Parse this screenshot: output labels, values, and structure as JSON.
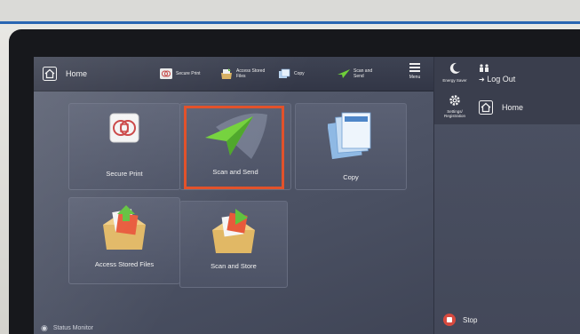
{
  "header": {
    "home_label": "Home",
    "shortcuts": [
      {
        "label": "Secure Print"
      },
      {
        "label": "Access Stored Files"
      },
      {
        "label": "Copy"
      },
      {
        "label": "Scan and Send"
      }
    ],
    "menu_label": "Menu"
  },
  "right_panel": {
    "energy_saver": "Energy Saver",
    "logout_label": "Log Out",
    "settings_label": "Settings/ Registration",
    "home_label": "Home",
    "stop_label": "Stop"
  },
  "tiles": [
    {
      "label": "Secure Print"
    },
    {
      "label": "Scan and Send"
    },
    {
      "label": "Copy"
    },
    {
      "label": "Access Stored Files"
    },
    {
      "label": "Scan and Store"
    }
  ],
  "status_bar": {
    "label": "Status Monitor"
  },
  "colors": {
    "highlight": "#e2522b",
    "accent_line": "#2a66b3"
  }
}
